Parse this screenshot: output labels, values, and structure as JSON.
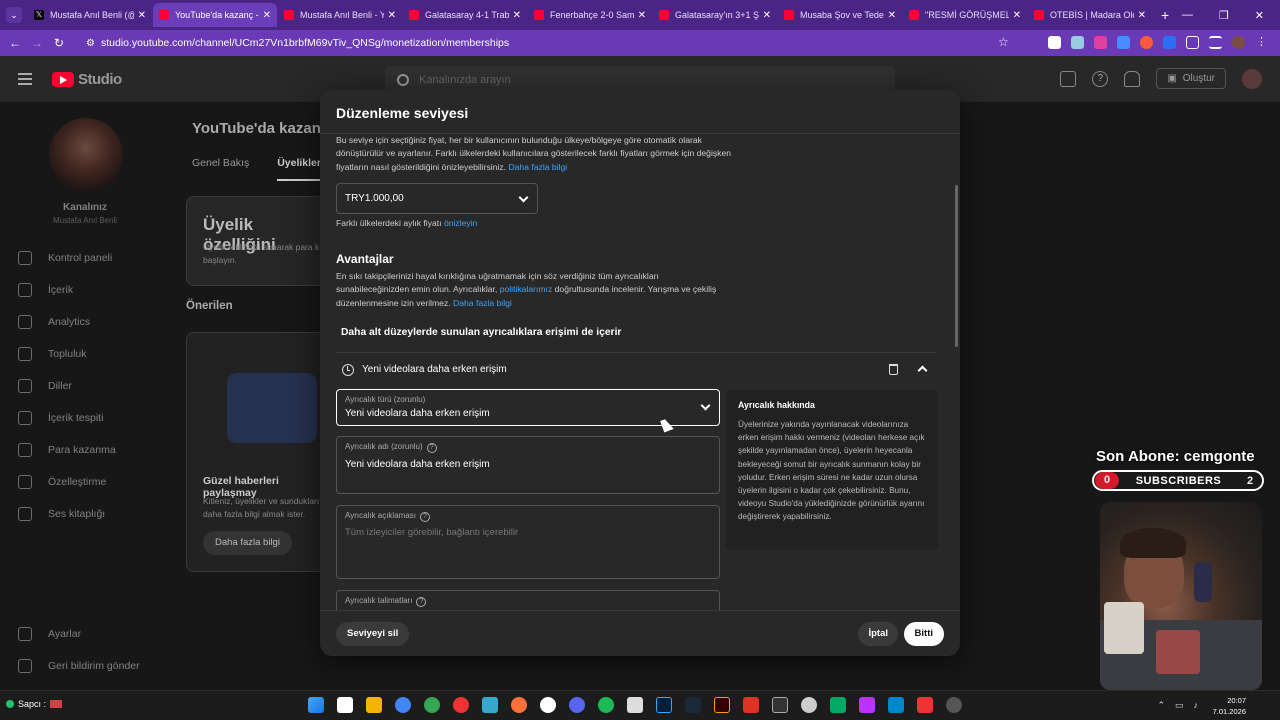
{
  "browser": {
    "tabs": [
      {
        "label": "Mustafa Anıl Benli (@",
        "favicon": "x-icon",
        "active": false
      },
      {
        "label": "YouTube'da kazanç -",
        "favicon": "youtube-icon",
        "active": true
      },
      {
        "label": "Mustafa Anıl Benli - Y",
        "favicon": "youtube-icon",
        "active": false
      },
      {
        "label": "Galatasaray 4-1 Trabz",
        "favicon": "youtube-icon",
        "active": false
      },
      {
        "label": "Fenerbahçe 2-0 Sams",
        "favicon": "youtube-icon",
        "active": false
      },
      {
        "label": "Galatasaray'ın 3+1 Şi",
        "favicon": "youtube-icon",
        "active": false
      },
      {
        "label": "Musaba Şov ve Teder",
        "favicon": "youtube-icon",
        "active": false
      },
      {
        "label": "\"RESMİ GÖRÜŞMELER",
        "favicon": "youtube-icon",
        "active": false
      },
      {
        "label": "OTEBİS | Madara Old",
        "favicon": "youtube-icon",
        "active": false
      }
    ],
    "url": "studio.youtube.com/channel/UCm27Vn1brbfM69vTiv_QNSg/monetization/memberships",
    "accent": "#6a3ab6"
  },
  "studio": {
    "logo_text": "Studio",
    "search_placeholder": "Kanalınızda arayın",
    "create_label": "Oluştur",
    "channel_label": "Kanalınız",
    "channel_name": "Mustafa Anıl Benli",
    "nav": [
      {
        "label": "Kontrol paneli",
        "icon": "dashboard-icon"
      },
      {
        "label": "İçerik",
        "icon": "content-icon"
      },
      {
        "label": "Analytics",
        "icon": "analytics-icon"
      },
      {
        "label": "Topluluk",
        "icon": "community-icon"
      },
      {
        "label": "Diller",
        "icon": "languages-icon"
      },
      {
        "label": "İçerik tespiti",
        "icon": "copyright-icon"
      },
      {
        "label": "Para kazanma",
        "icon": "monetization-icon"
      },
      {
        "label": "Özelleştirme",
        "icon": "customization-icon"
      },
      {
        "label": "Ses kitaplığı",
        "icon": "audio-library-icon"
      }
    ],
    "nav_bottom": [
      {
        "label": "Ayarlar",
        "icon": "settings-icon"
      },
      {
        "label": "Geri bildirim gönder",
        "icon": "feedback-icon"
      }
    ],
    "page_title": "YouTube'da kazanç",
    "page_tabs": [
      "Genel Bakış",
      "Üyelikler"
    ],
    "card_title": "Üyelik özelliğini",
    "card_text": "Üyelik teklifinizi sunarak para k başlayın.",
    "suggestions_title": "Önerilen",
    "promo_title": "Güzel haberleri paylaşmay",
    "promo_text": "Kitleniz, üyelikler ve sundukları daha fazla bilgi almak ister.",
    "promo_button": "Daha fazla bilgi"
  },
  "dialog": {
    "title": "Düzenleme seviyesi",
    "price_intro_1": "Bu seviye için seçtiğiniz fiyat, her bir kullanıcının bulunduğu ülkeye/bölgeye göre otomatik olarak",
    "price_intro_2": "dönüştürülür ve ayarlanır. Farklı ülkelerdeki kullanıcılara gösterilecek farklı fiyatları görmek için değişken",
    "price_intro_3": "fiyatların nasıl gösterildiğini önizleyebilirsiniz.",
    "learn_more": "Daha fazla bilgi",
    "price_value": "TRY1.000,00",
    "preview_note": "Farklı ülkelerdeki aylık fiyatı",
    "preview_link": "önizleyin",
    "perks_title": "Avantajlar",
    "perks_text_1": "En sıkı takipçilerinizi hayal kırıklığına uğratmamak için söz verdiğiniz tüm ayrıcalıkları",
    "perks_text_2a": "sunabileceğinizden emin olun. Ayrıcalıklar,",
    "policies_link": "politikalarımız",
    "perks_text_2b": "doğrultusunda incelenir. Yarışma ve çekiliş",
    "perks_text_3": "düzenlenmesine izin verilmez.",
    "lower_tiers": "Daha alt düzeylerde sunulan ayrıcalıklara erişimi de içerir",
    "perk_name": "Yeni videolara daha erken erişim",
    "type_label": "Ayrıcalık türü (zorunlu)",
    "type_value": "Yeni videolara daha erken erişim",
    "name_label": "Ayrıcalık adı (zorunlu)",
    "name_value": "Yeni videolara daha erken erişim",
    "desc_label": "Ayrıcalık açıklaması",
    "desc_placeholder": "Tüm izleyiciler görebilir, bağlantı içerebilir",
    "instructions_label": "Ayrıcalık talimatları",
    "about_title": "Ayrıcalık hakkında",
    "about_text": "Üyelerinize yakında yayınlanacak videolarınıza erken erişim hakkı vermeniz (videoları herkese açık şekilde yayınlamadan önce), üyelerin heyecanla bekleyeceği somut bir ayrıcalık sunmanın kolay bir yoludur. Erken erişim süresi ne kadar uzun olursa üyelerin ilgisini o kadar çok çekebilirsiniz. Bunu, videoyu Studio'da yüklediğinizde görünürlük ayarını değiştirerek yapabilirsiniz.",
    "delete_button": "Seviyeyi sil",
    "cancel_button": "İptal",
    "done_button": "Bitti"
  },
  "overlay": {
    "last_sub": "Son Abone: cemgonte",
    "left_count": "0",
    "subs_label": "SUBSCRIBERS",
    "right_count": "2"
  },
  "taskbar": {
    "weather": "Sapcı :",
    "time": "20:07",
    "date": "7.01.2026"
  }
}
